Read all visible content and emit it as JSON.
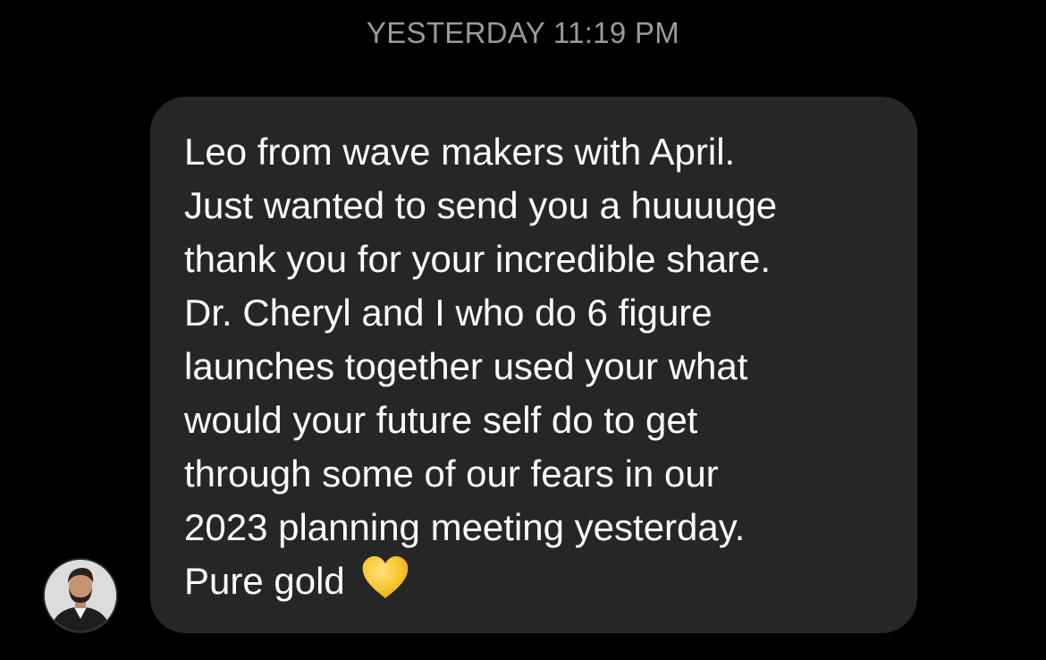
{
  "thread": {
    "timestamp": "YESTERDAY 11:19 PM"
  },
  "message": {
    "sender_avatar": "avatar-photo",
    "lines": [
      "Leo from wave makers with April.",
      "Just wanted to send you a huuuuge",
      "thank you for your incredible share.",
      "Dr. Cheryl and I who do 6 figure",
      "launches together used your what",
      "would your future self do to get",
      "through some of our fears in our",
      "2023 planning meeting yesterday.",
      "Pure gold"
    ],
    "emoji": "yellow-heart-icon"
  },
  "colors": {
    "background": "#000000",
    "bubble": "#262626",
    "text": "#ffffff",
    "timestamp": "#9a9a9a",
    "heart": "#f7c52b"
  }
}
